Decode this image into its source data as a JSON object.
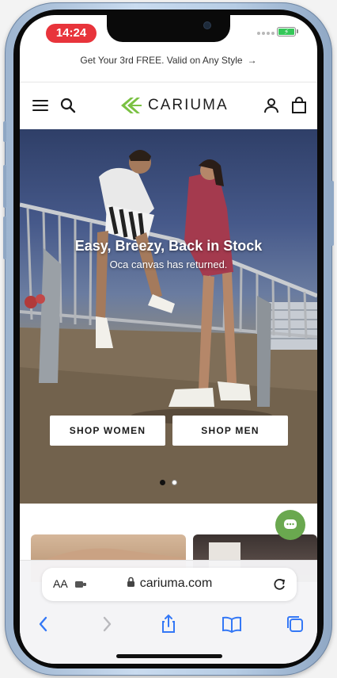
{
  "status_bar": {
    "time": "14:24"
  },
  "promo_banner": {
    "text": "Get Your 3rd FREE. Valid on Any Style",
    "arrow": "→"
  },
  "header": {
    "brand": "CARIUMA",
    "icons": [
      "menu-icon",
      "search-icon",
      "account-icon",
      "bag-icon"
    ]
  },
  "hero": {
    "title": "Easy, Breezy, Back in Stock",
    "subtitle": "Oca canvas has returned.",
    "buttons": {
      "shop_women": "SHOP WOMEN",
      "shop_men": "SHOP MEN"
    },
    "slides": {
      "count": 2,
      "active": 1
    }
  },
  "safari": {
    "text_size_label": "AA",
    "url": "cariuma.com"
  },
  "colors": {
    "status_pill": "#e8343b",
    "battery": "#35c759",
    "brand_green": "#7ac143",
    "chat_button": "#6aa84f",
    "safari_blue": "#3478f6"
  }
}
